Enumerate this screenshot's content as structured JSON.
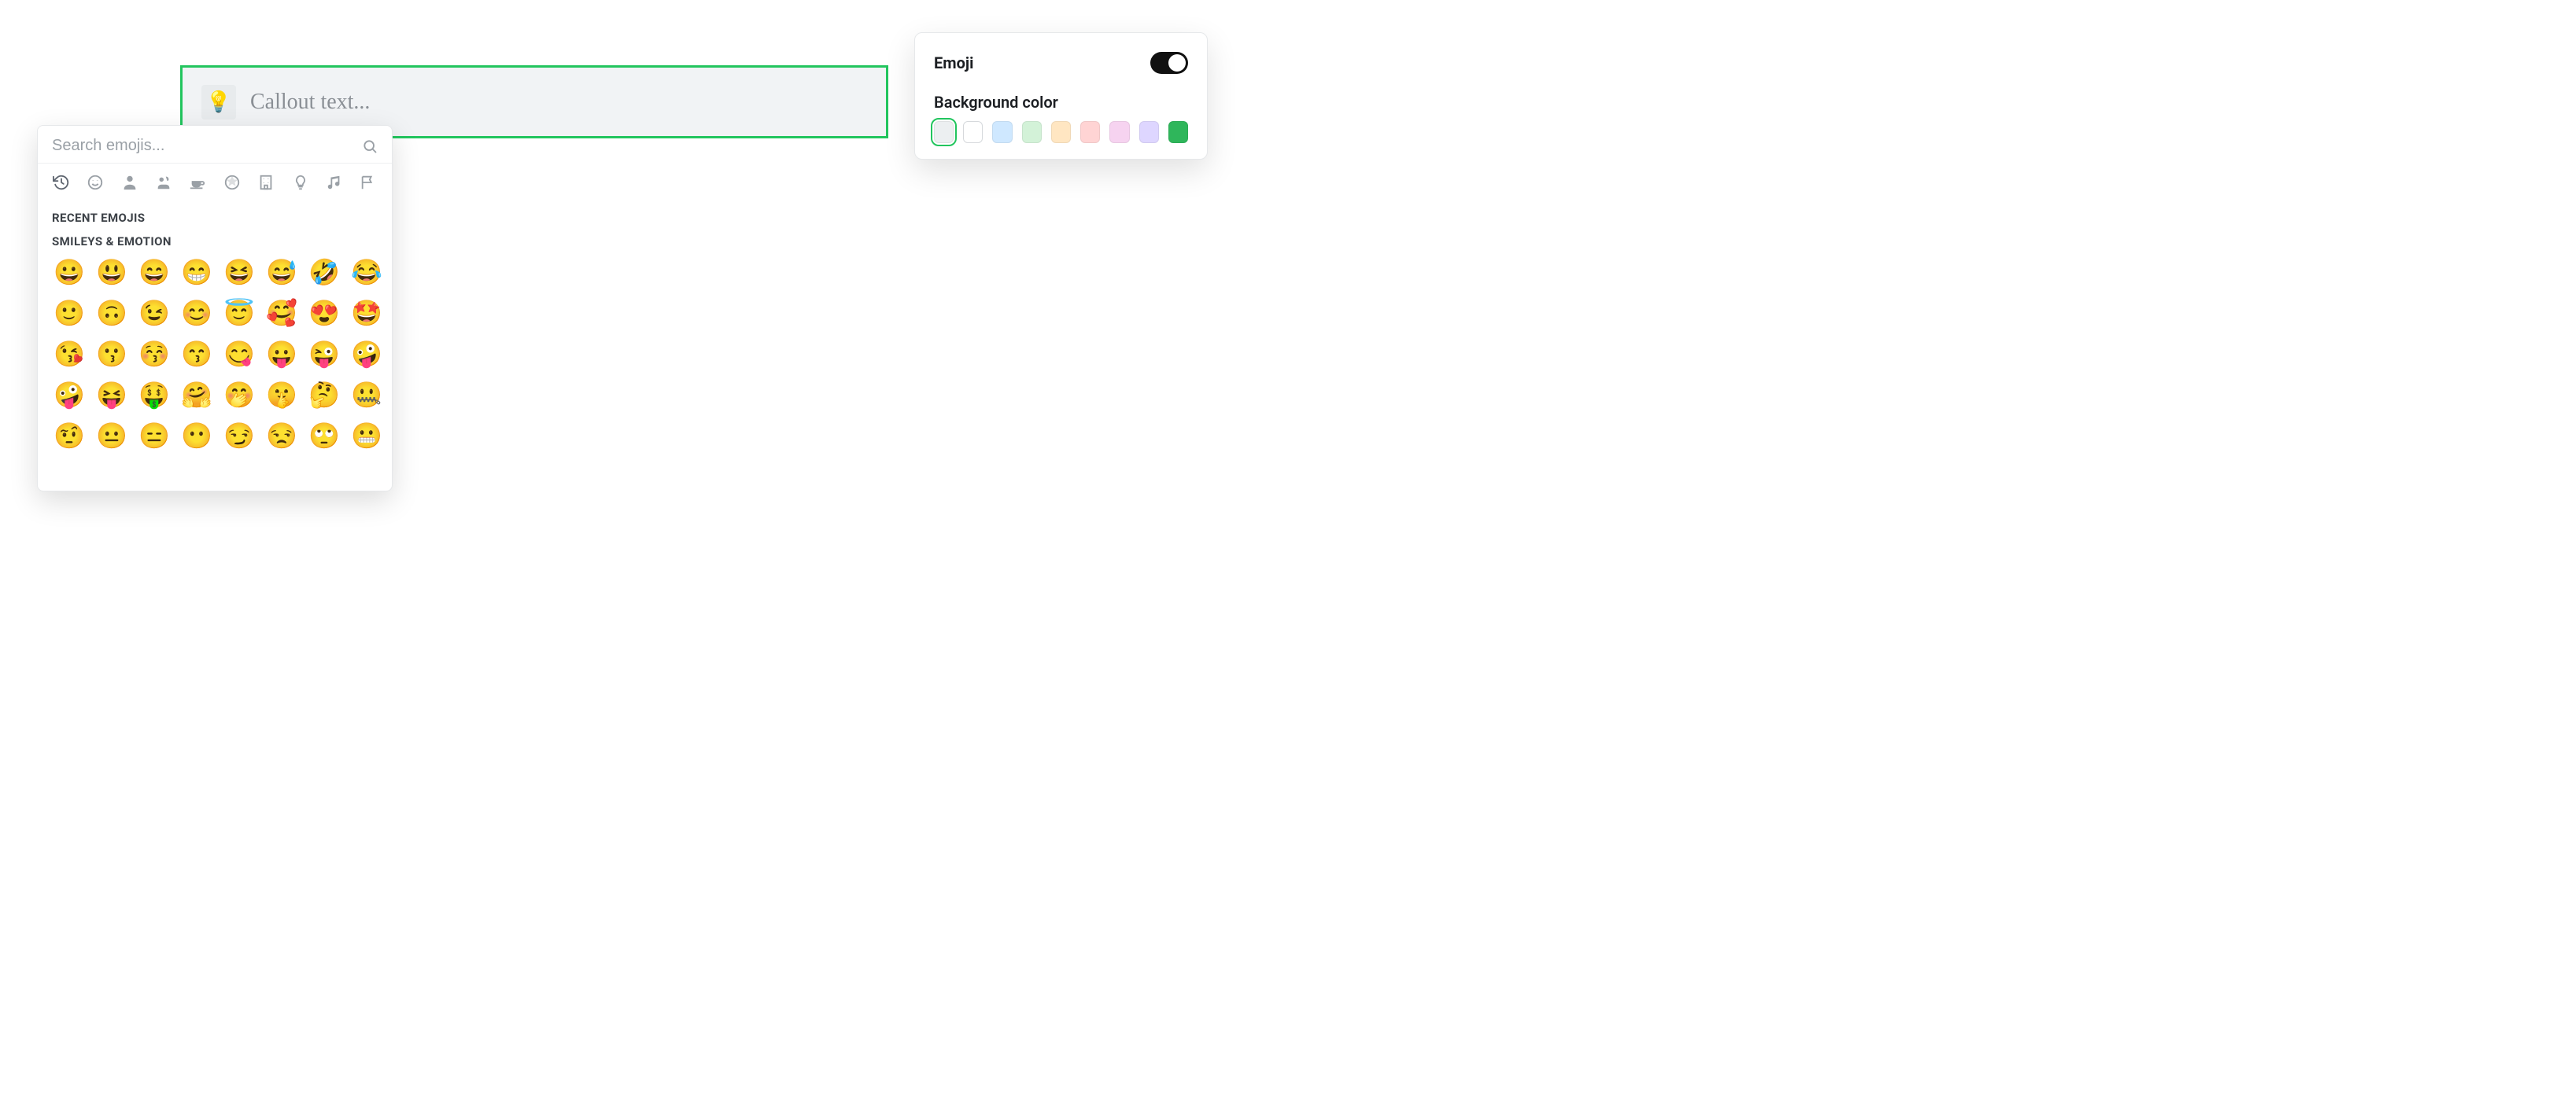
{
  "callout": {
    "icon": "💡",
    "placeholder": "Callout text..."
  },
  "emoji_picker": {
    "search_placeholder": "Search emojis...",
    "categories": [
      {
        "id": "recent",
        "icon": "history"
      },
      {
        "id": "smileys",
        "icon": "smile"
      },
      {
        "id": "people",
        "icon": "person"
      },
      {
        "id": "animals",
        "icon": "cat"
      },
      {
        "id": "food",
        "icon": "coffee"
      },
      {
        "id": "activity",
        "icon": "soccer"
      },
      {
        "id": "travel",
        "icon": "building"
      },
      {
        "id": "objects",
        "icon": "bulb"
      },
      {
        "id": "symbols",
        "icon": "music"
      },
      {
        "id": "flags",
        "icon": "flag"
      }
    ],
    "sections": {
      "recent": {
        "title": "RECENT EMOJIS",
        "items": []
      },
      "smileys": {
        "title": "SMILEYS & EMOTION",
        "items": [
          "😀",
          "😃",
          "😄",
          "😁",
          "😆",
          "😅",
          "🤣",
          "😂",
          "🙂",
          "🙃",
          "😉",
          "😊",
          "😇",
          "🥰",
          "😍",
          "🤩",
          "😘",
          "😗",
          "😚",
          "😙",
          "😋",
          "😛",
          "😜",
          "🤪",
          "🤪",
          "😝",
          "🤑",
          "🤗",
          "🤭",
          "🤫",
          "🤔",
          "🤐",
          "🤨",
          "😐",
          "😑",
          "😶",
          "😏",
          "😒",
          "🙄",
          "😬"
        ]
      }
    }
  },
  "settings": {
    "emoji_label": "Emoji",
    "emoji_enabled": true,
    "bg_label": "Background color",
    "colors": [
      {
        "hex": "#eceff1",
        "selected": true
      },
      {
        "hex": "#ffffff",
        "selected": false
      },
      {
        "hex": "#cfe8ff",
        "selected": false
      },
      {
        "hex": "#d3f2d8",
        "selected": false
      },
      {
        "hex": "#ffe6c2",
        "selected": false
      },
      {
        "hex": "#ffd4d4",
        "selected": false
      },
      {
        "hex": "#f6d3f0",
        "selected": false
      },
      {
        "hex": "#ded6ff",
        "selected": false
      },
      {
        "hex": "#2fb65b",
        "selected": false
      }
    ]
  }
}
